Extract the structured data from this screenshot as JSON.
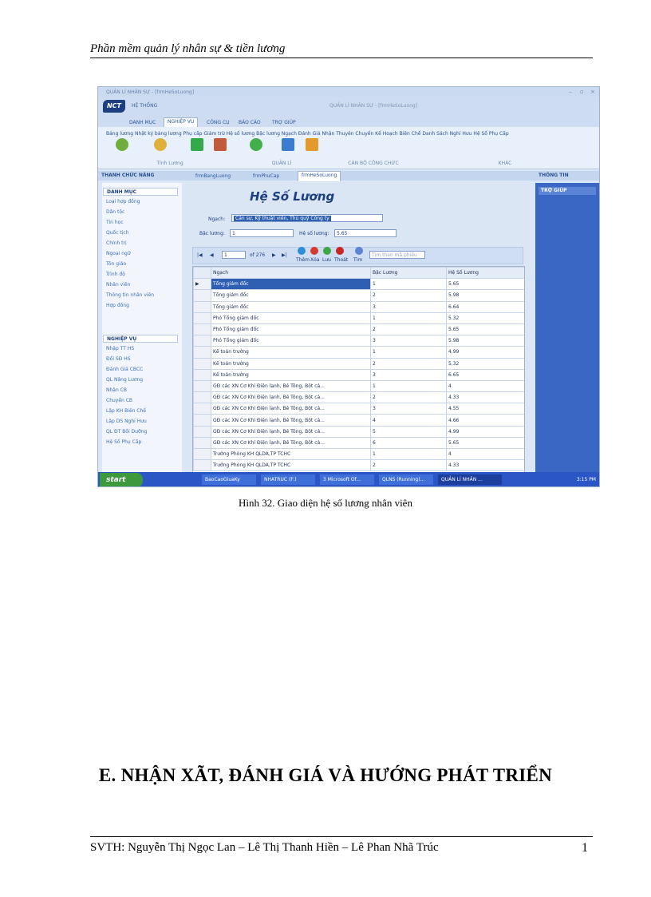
{
  "header": {
    "title": "Phần mềm quản lý nhân sự & tiền lương"
  },
  "app": {
    "window_title": "QUẢN LÍ NHÂN SỰ - [frmHeSoLuong]",
    "window_title_mid": "QUẢN LÍ NHÂN SỰ - [frmHeSoLuong]",
    "logo_text": "NCT",
    "system_menu": "HỆ THỐNG",
    "menu_tabs": [
      "DANH MỤC",
      "NGHIỆP VỤ",
      "CÔNG CỤ",
      "BÁO CÁO",
      "TRỢ GIÚP"
    ],
    "ribbon_labels": "Bảng lương  Nhật ký bảng lương  Phụ cấp  Giảm trừ    Hệ số lương  Bậc lương  Ngạch      Đánh Giá  Nhận  Thuyên Chuyển    Kế Hoạch Biên Chế  Danh Sách Nghỉ Hưu  Hệ Số Phụ Cấp",
    "ribbon_groups": [
      "Tính Lương",
      "QUẢN LÍ",
      "CÁN BỘ CÔNG CHỨC",
      "KHÁC"
    ],
    "left_panel_title": "THANH CHỨC NĂNG",
    "doc_tabs": [
      "frmBangLuong",
      "frmPhuCap",
      "frmHeSoLuong"
    ],
    "right_panel_title": "THÔNG TIN",
    "help_title": "TRỢ GIÚP",
    "sidebar": {
      "danh_muc": {
        "title": "DANH MỤC",
        "items": [
          "Loại hợp đồng",
          "Dân tộc",
          "Tin học",
          "Quốc tịch",
          "Chính trị",
          "Ngoại ngữ",
          "Tôn giáo",
          "Trình độ",
          "Nhân viên",
          "Thông tin nhân viên",
          "Hợp đồng"
        ]
      },
      "nghiep_vu": {
        "title": "NGHIỆP VỤ",
        "items": [
          "Nhập TT HS",
          "Đổi SĐ HS",
          "Đánh Giá CBCC",
          "QL Nâng Lương",
          "Nhận CB",
          "Chuyển CB",
          "Lập KH Biên Chế",
          "Lập DS Nghỉ Hưu",
          "QL ĐT Bồi Dưỡng",
          "Hệ Số Phụ Cấp"
        ]
      }
    },
    "form": {
      "title": "Hệ Số Lương",
      "ngach_label": "Ngạch:",
      "ngach_value": "Cán sự, Kỹ thuật viên, Thủ quỹ Công ty",
      "bac_label": "Bậc lương:",
      "bac_value": "1",
      "heso_label": "Hệ số lương:",
      "heso_value": "5.65"
    },
    "navigator": {
      "position": "1",
      "of_text": "of 276",
      "buttons": [
        "Thêm",
        "Xóa",
        "Lưu",
        "Thoát",
        "Tìm"
      ],
      "search_placeholder": "Tìm theo mã phiếu"
    },
    "grid": {
      "headers": [
        "Ngạch",
        "Bậc Lương",
        "Hệ Số Lương"
      ],
      "rows": [
        [
          "Tổng giám đốc",
          "1",
          "5.65"
        ],
        [
          "Tổng giám đốc",
          "2",
          "5.98"
        ],
        [
          "Tổng giám đốc",
          "3",
          "6.64"
        ],
        [
          "Phó Tổng giám đốc",
          "1",
          "5.32"
        ],
        [
          "Phó Tổng giám đốc",
          "2",
          "5.65"
        ],
        [
          "Phó Tổng giám đốc",
          "3",
          "5.98"
        ],
        [
          "Kế toán trưởng",
          "1",
          "4.99"
        ],
        [
          "Kế toán trưởng",
          "2",
          "5.32"
        ],
        [
          "Kế toán trưởng",
          "3",
          "6.65"
        ],
        [
          "GĐ các XN Cơ Khí Điện lạnh, Bê Tông, Bột cá...",
          "1",
          "4"
        ],
        [
          "GĐ các XN Cơ Khí Điện lạnh, Bê Tông, Bột cá...",
          "2",
          "4.33"
        ],
        [
          "GĐ các XN Cơ Khí Điện lạnh, Bê Tông, Bột cá...",
          "3",
          "4.55"
        ],
        [
          "GĐ các XN Cơ Khí Điện lạnh, Bê Tông, Bột cá...",
          "4",
          "4.66"
        ],
        [
          "GĐ các XN Cơ Khí Điện lạnh, Bê Tông, Bột cá...",
          "5",
          "4.99"
        ],
        [
          "GĐ các XN Cơ Khí Điện lạnh, Bê Tông, Bột cá...",
          "6",
          "5.65"
        ],
        [
          "Trưởng Phòng KH QLDA,TP TCHC",
          "1",
          "4"
        ],
        [
          "Trưởng Phòng KH QLDA,TP TCHC",
          "2",
          "4.33"
        ]
      ]
    },
    "taskbar": {
      "start": "start",
      "items": [
        "BaoCaoGiuaKy",
        "NHATRUC (F:)",
        "3 Microsoft Of...",
        "QLNS (Running)...",
        "QUẢN LÍ NHÂN ..."
      ],
      "clock": "3:15 PM"
    }
  },
  "caption": "Hình 32. Giao diện hệ số lương nhân viên",
  "section_title": "E. NHẬN XÃT, ĐÁNH GIÁ VÀ HƯỚNG PHÁT TRIỂN",
  "footer": {
    "authors": "SVTH: Nguyễn Thị Ngọc Lan – Lê Thị Thanh Hiền – Lê Phan Nhã Trúc",
    "page_number": "1"
  }
}
